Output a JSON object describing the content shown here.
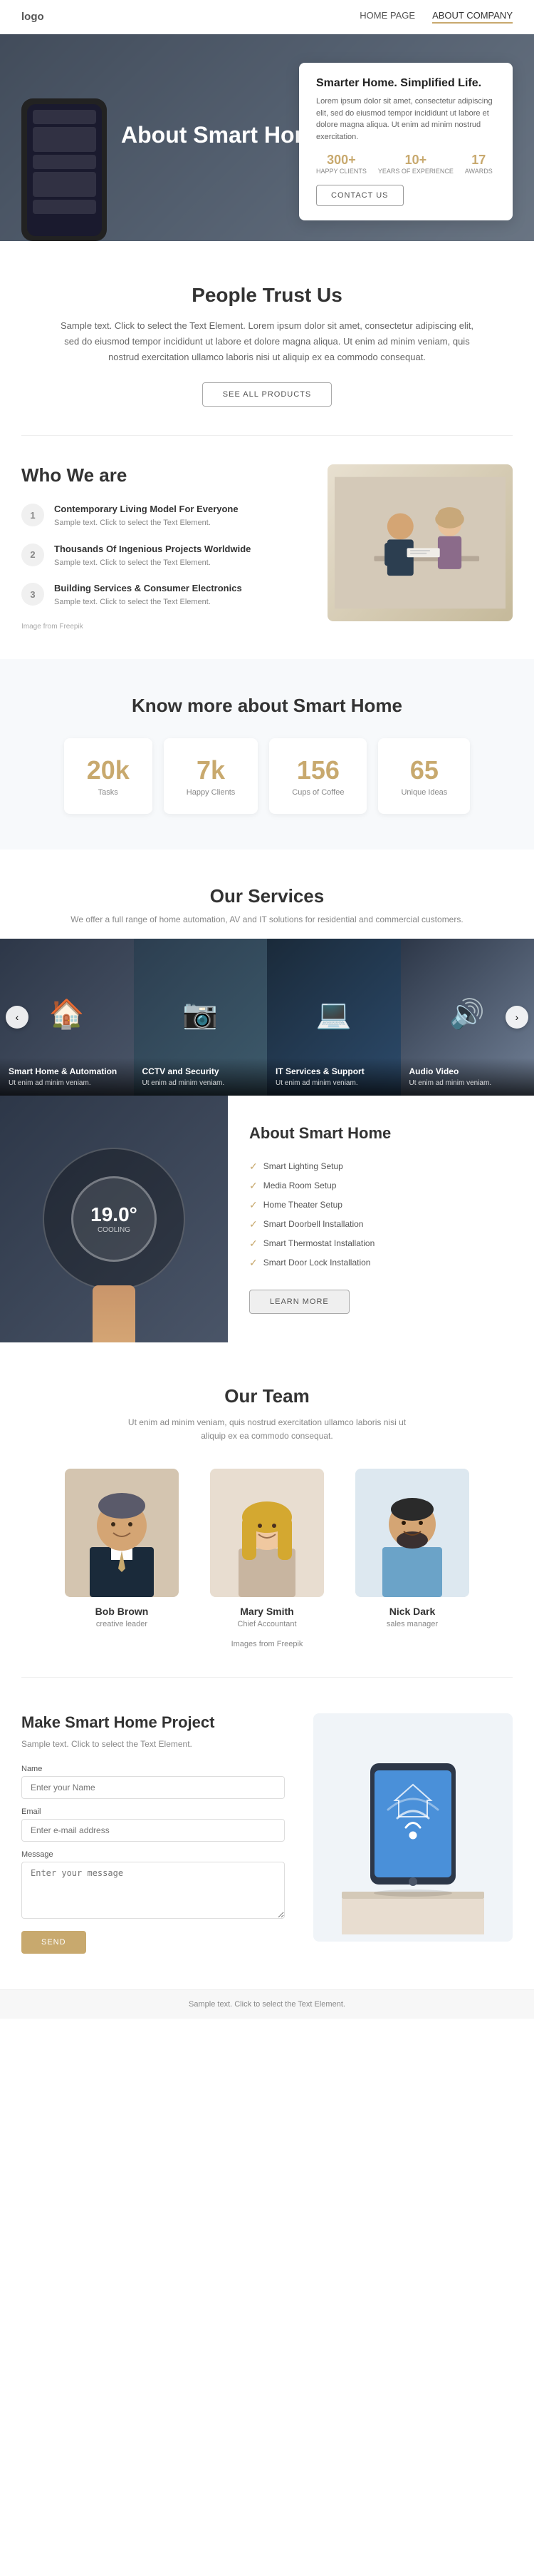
{
  "nav": {
    "logo": "logo",
    "links": [
      {
        "label": "HOME PAGE",
        "active": false
      },
      {
        "label": "ABOUT COMPANY",
        "active": true
      }
    ]
  },
  "hero": {
    "title": "About Smart Homes",
    "card": {
      "heading": "Smarter Home. Simplified Life.",
      "body": "Lorem ipsum dolor sit amet, consectetur adipiscing elit, sed do eiusmod tempor incididunt ut labore et dolore magna aliqua. Ut enim ad minim nostrud exercitation.",
      "stats": [
        {
          "num": "300+",
          "label": "HAPPY CLIENTS"
        },
        {
          "num": "10+",
          "label": "YEARS OF EXPERIENCE"
        },
        {
          "num": "17",
          "label": "AWARDS"
        }
      ],
      "contact_btn": "CONTACT US"
    }
  },
  "trust": {
    "heading": "People Trust Us",
    "body": "Sample text. Click to select the Text Element. Lorem ipsum dolor sit amet, consectetur adipiscing elit, sed do eiusmod tempor incididunt ut labore et dolore magna aliqua. Ut enim ad minim veniam, quis nostrud exercitation ullamco laboris nisi ut aliquip ex ea commodo consequat.",
    "btn": "SEE ALL PRODUCTS"
  },
  "who": {
    "heading": "Who We are",
    "items": [
      {
        "num": "1",
        "title": "Contemporary Living Model For Everyone",
        "body": "Sample text. Click to select the Text Element."
      },
      {
        "num": "2",
        "title": "Thousands Of Ingenious Projects Worldwide",
        "body": "Sample text. Click to select the Text Element."
      },
      {
        "num": "3",
        "title": "Building Services & Consumer Electronics",
        "body": "Sample text. Click to select the Text Element."
      }
    ],
    "image_caption": "Image from Freepik"
  },
  "knowmore": {
    "heading": "Know more about Smart Home",
    "stats": [
      {
        "num": "20k",
        "label": "Tasks"
      },
      {
        "num": "7k",
        "label": "Happy Clients"
      },
      {
        "num": "156",
        "label": "Cups of Coffee"
      },
      {
        "num": "65",
        "label": "Unique Ideas"
      }
    ]
  },
  "services": {
    "heading": "Our Services",
    "subtext": "We offer a full range of home automation, AV and IT solutions for residential and commercial customers.",
    "cards": [
      {
        "title": "Smart Home & Automation",
        "body": "Ut enim ad minim veniam."
      },
      {
        "title": "CCTV and Security",
        "body": "Ut enim ad minim veniam."
      },
      {
        "title": "IT Services & Support",
        "body": "Ut enim ad minim veniam."
      },
      {
        "title": "Audio Video",
        "body": "Ut enim ad minim veniam."
      }
    ]
  },
  "about_home": {
    "heading": "About Smart Home",
    "thermostat_display": "19.0°",
    "thermostat_label": "COOLING",
    "features": [
      "Smart Lighting Setup",
      "Media Room Setup",
      "Home Theater Setup",
      "Smart Doorbell Installation",
      "Smart Thermostat Installation",
      "Smart Door Lock Installation"
    ],
    "btn": "LEARN MORE"
  },
  "team": {
    "heading": "Our Team",
    "sub": "Ut enim ad minim veniam, quis nostrud exercitation ullamco laboris nisi ut aliquip ex ea commodo consequat.",
    "members": [
      {
        "name": "Bob Brown",
        "role": "creative leader"
      },
      {
        "name": "Mary Smith",
        "role": "Chief Accountant"
      },
      {
        "name": "Nick Dark",
        "role": "sales manager"
      }
    ],
    "caption": "Images from Freepik"
  },
  "contact": {
    "heading": "Make Smart Home Project",
    "sub": "Sample text. Click to select the Text Element.",
    "fields": {
      "name_label": "Name",
      "name_placeholder": "Enter your Name",
      "email_label": "Email",
      "email_placeholder": "Enter e-mail address",
      "message_label": "Message",
      "message_placeholder": "Enter your message"
    },
    "btn": "SEND"
  },
  "footer": {
    "text": "Sample text. Click to select the Text Element."
  }
}
